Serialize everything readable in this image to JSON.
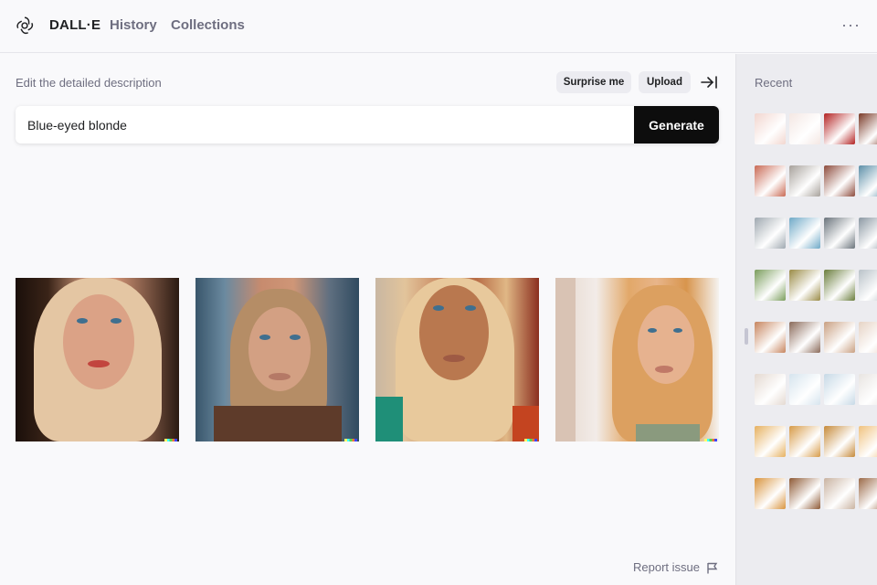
{
  "header": {
    "brand": "DALL·E",
    "nav": [
      "History",
      "Collections"
    ],
    "more": "···"
  },
  "main": {
    "edit_label": "Edit the detailed description",
    "surprise_label": "Surprise me",
    "upload_label": "Upload",
    "prompt_value": "Blue-eyed blonde",
    "generate_label": "Generate",
    "report_label": "Report issue"
  },
  "results": [
    {
      "subject": "blonde woman portrait, blue eyes, red lips"
    },
    {
      "subject": "blonde bob haircut woman, patterned background"
    },
    {
      "subject": "long straight blonde hair woman, teal top"
    },
    {
      "subject": "long ginger-blonde hair woman, pendant necklace"
    }
  ],
  "sidebar": {
    "title": "Recent"
  },
  "recent_rows": [
    {
      "subject": "smiling lips",
      "colors": [
        "#f2d6cf",
        "#f4e7e3",
        "#b32222",
        "#7a3a28"
      ]
    },
    {
      "subject": "women in red dress",
      "colors": [
        "#c96a55",
        "#a7a19b",
        "#8d4b3c",
        "#5d8fa8"
      ]
    },
    {
      "subject": "riverside city",
      "colors": [
        "#9fa8b0",
        "#6fa9c7",
        "#6a737b",
        "#8b98a3"
      ]
    },
    {
      "subject": "autumn trees",
      "colors": [
        "#7a9d5c",
        "#9a8b46",
        "#6a7d3c",
        "#b9c2c8"
      ]
    },
    {
      "subject": "woman portraits",
      "colors": [
        "#c7855f",
        "#8a6a5a",
        "#c9a082",
        "#e6d3c5"
      ]
    },
    {
      "subject": "kittens",
      "colors": [
        "#e4d9d1",
        "#d6e4ee",
        "#c7d9e6",
        "#e8e4e1"
      ]
    },
    {
      "subject": "bride at sunset",
      "colors": [
        "#e6b160",
        "#d79b48",
        "#c68a3a",
        "#f0c27e"
      ]
    },
    {
      "subject": "couple at dusk",
      "colors": [
        "#d9943e",
        "#8e5a35",
        "#c9b3a1",
        "#9b6a48"
      ]
    }
  ],
  "colors": {
    "background": "#f9f9fb",
    "sidebar": "#ececf0",
    "button_dark": "#0d0d0d",
    "muted_text": "#6e6e80"
  },
  "icons": [
    "openai-logo-icon",
    "more-icon",
    "collapse-sidebar-icon",
    "flag-icon"
  ]
}
